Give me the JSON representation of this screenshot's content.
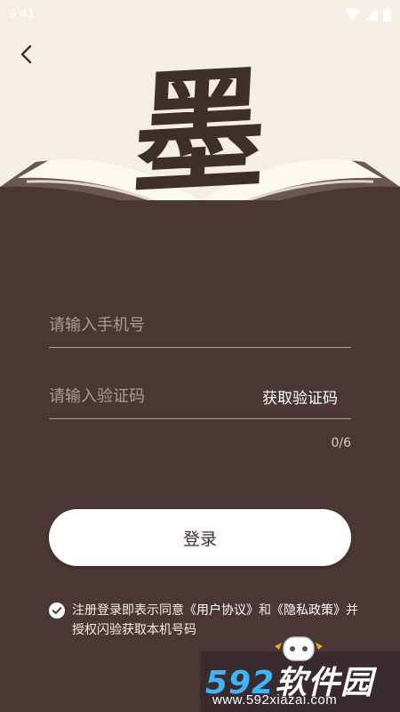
{
  "status_bar": {
    "time": "9:41",
    "icons": [
      "wifi-icon",
      "signal-icon",
      "battery-icon"
    ]
  },
  "header": {
    "back_icon": "chevron-left-icon",
    "logo_char": "墨"
  },
  "form": {
    "phone_placeholder": "请输入手机号",
    "code_placeholder": "请输入验证码",
    "get_code_label": "获取验证码",
    "code_counter": "0/6",
    "login_label": "登录"
  },
  "agreement": {
    "prefix": "注册登录即表示同意",
    "user_agreement": "《用户协议》",
    "conjunction": "和",
    "privacy_policy": "《隐私政策》",
    "suffix": "并授权闪验获取本机号码",
    "checked": true
  },
  "watermark": {
    "brand_number": "592",
    "brand_text": "软件园",
    "url": "www.592xiazai.com"
  },
  "colors": {
    "panel_bg": "#4b3735",
    "top_bg": "#f4eee4",
    "ink": "#3e2f2c",
    "button_bg": "#ffffff"
  }
}
